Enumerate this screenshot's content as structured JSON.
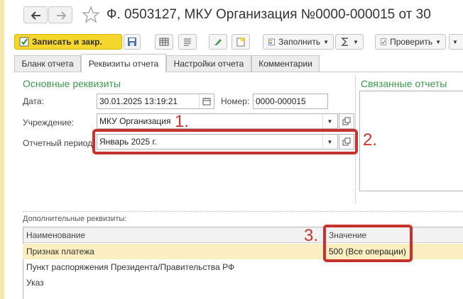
{
  "header": {
    "title": "Ф. 0503127, МКУ Организация №0000-000015 от 30"
  },
  "toolbar": {
    "save_close": "Записать и закр.",
    "fill": "Заполнить",
    "check": "Проверить"
  },
  "tabs": [
    {
      "label": "Бланк отчета"
    },
    {
      "label": "Реквизиты отчета"
    },
    {
      "label": "Настройки отчета"
    },
    {
      "label": "Комментарии"
    }
  ],
  "main": {
    "section_title": "Основные реквизиты",
    "date_label": "Дата:",
    "date_value": "30.01.2025 13:19:21",
    "number_label": "Номер:",
    "number_value": "0000-000015",
    "org_label": "Учреждение:",
    "org_value": "МКУ Организация",
    "period_label": "Отчетный период:",
    "period_value": "Январь 2025 г."
  },
  "related": {
    "title": "Связанные отчеты"
  },
  "additional": {
    "title": "Дополнительные реквизиты:",
    "col_name": "Наименование",
    "col_value": "Значение",
    "rows": [
      {
        "name": "Признак платежа",
        "value": "500 (Все операции)"
      },
      {
        "name": "Пункт распоряжения Президента/Правительства РФ",
        "value": ""
      },
      {
        "name": "Указ",
        "value": ""
      }
    ]
  },
  "annotations": {
    "n1": "1.",
    "n2": "2.",
    "n3": "3."
  },
  "colors": {
    "accent_green": "#3b9a4d",
    "save_yellow": "#f5d62c",
    "highlight_red": "#c8322c",
    "selected_row": "#fbeec0"
  }
}
